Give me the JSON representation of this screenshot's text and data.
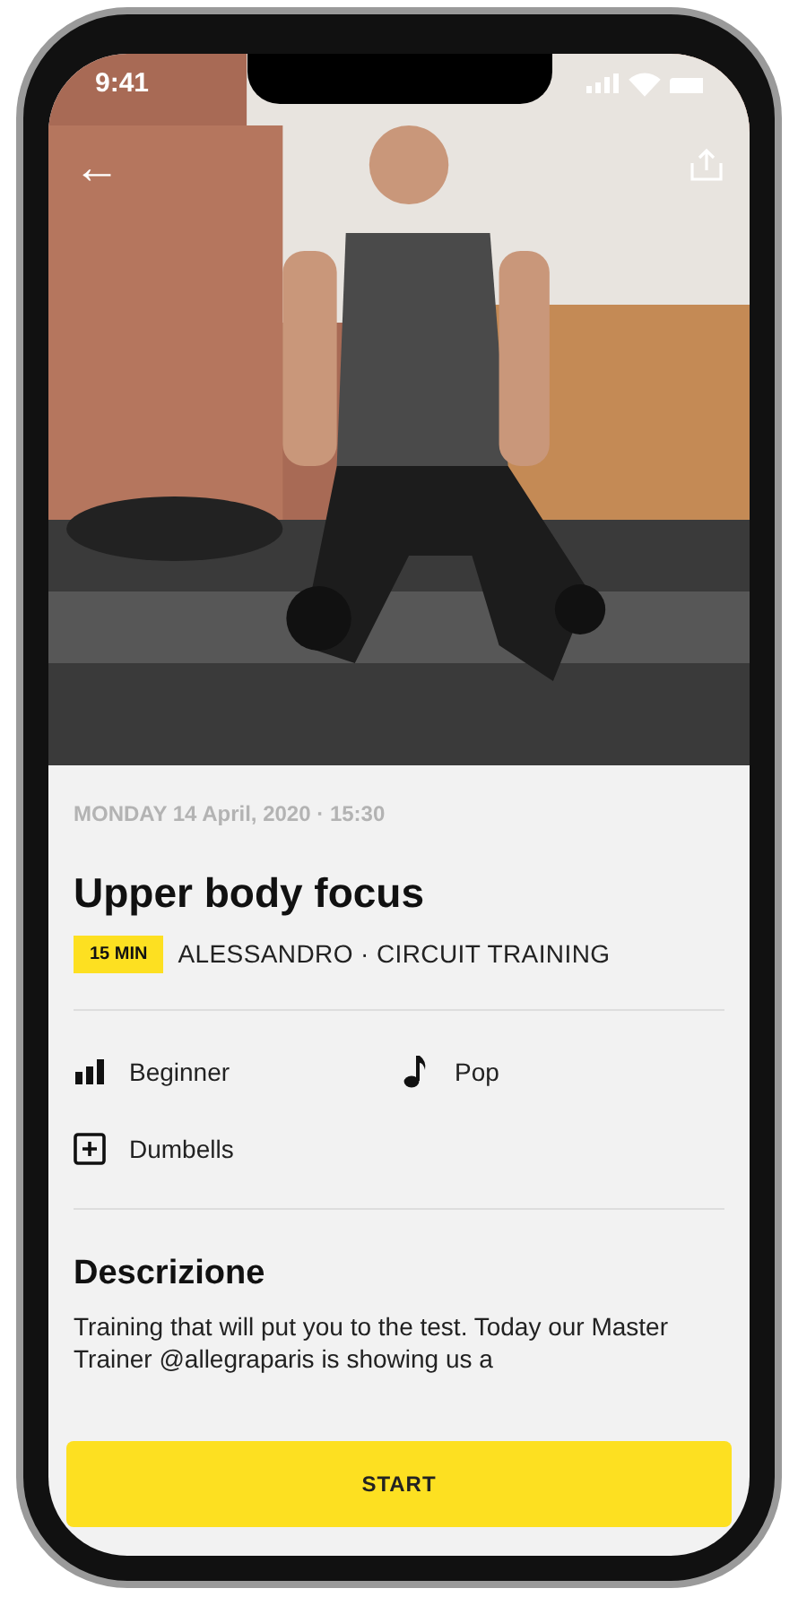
{
  "status_bar": {
    "time": "9:41"
  },
  "header": {
    "back": "←"
  },
  "workout": {
    "date": "MONDAY 14 April, 2020 · 15:30",
    "title": "Upper body focus",
    "duration": "15 MIN",
    "subtitle": "ALESSANDRO · CIRCUIT TRAINING"
  },
  "features": [
    {
      "kind": "level",
      "label": "Beginner"
    },
    {
      "kind": "music",
      "label": "Pop"
    },
    {
      "kind": "equipment",
      "label": "Dumbells"
    }
  ],
  "description": {
    "heading": "Descrizione",
    "text": "Training that will put you to the test. Today our Master Trainer @allegraparis is showing us a"
  },
  "start_button": "START"
}
